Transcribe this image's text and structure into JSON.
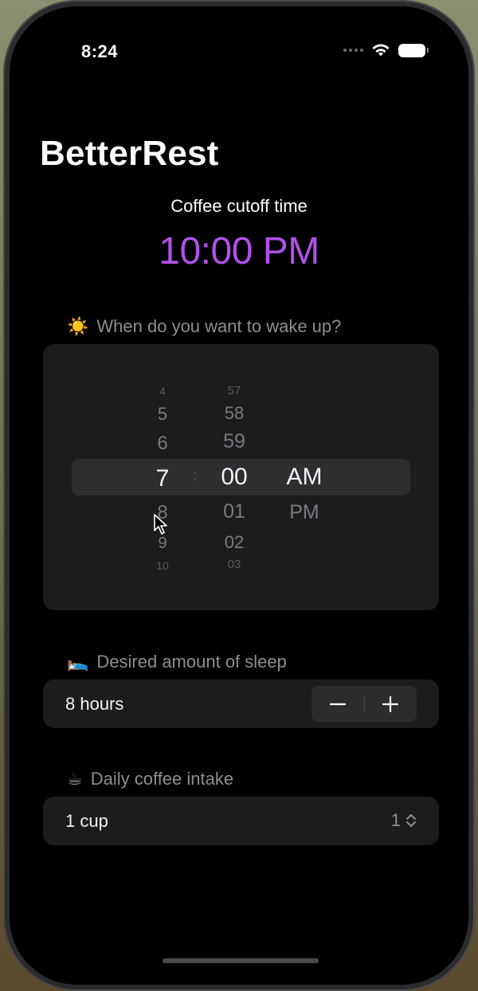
{
  "status_bar": {
    "time": "8:24"
  },
  "app": {
    "title": "BetterRest"
  },
  "cutoff": {
    "label": "Coffee cutoff time",
    "time": "10:00 PM"
  },
  "wake": {
    "emoji": "☀️",
    "header": "When do you want to wake up?",
    "hours": [
      "4",
      "5",
      "6",
      "7",
      "8",
      "9",
      "10"
    ],
    "selected_hour": "7",
    "minutes": [
      "57",
      "58",
      "59",
      "00",
      "01",
      "02",
      "03"
    ],
    "selected_minute": "00",
    "periods": [
      "AM",
      "PM"
    ],
    "selected_period": "AM"
  },
  "sleep": {
    "emoji": "🛌",
    "header": "Desired amount of sleep",
    "value": "8 hours",
    "decrement": "−",
    "increment": "+"
  },
  "coffee": {
    "emoji": "☕",
    "header": "Daily coffee intake",
    "value": "1 cup",
    "selected": "1"
  },
  "colors": {
    "accent": "#b051e8",
    "background": "#000000",
    "card": "#1c1c1e"
  }
}
